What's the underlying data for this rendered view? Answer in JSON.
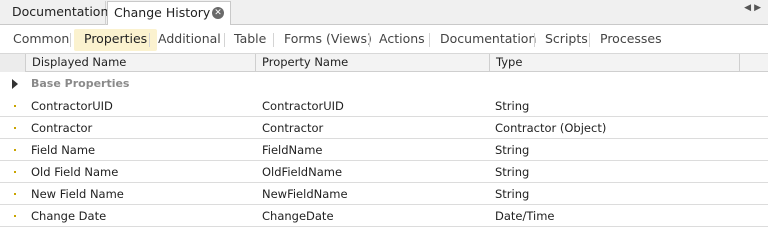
{
  "doc_tabs": [
    {
      "label": "Documentation"
    },
    {
      "label": "Change History *"
    }
  ],
  "close_glyph": "✕",
  "nav": {
    "prev": "◀",
    "next": "▶"
  },
  "sub_tabs": [
    {
      "label": "Common"
    },
    {
      "label": "Properties",
      "active": true
    },
    {
      "label": "Additional"
    },
    {
      "label": "Table"
    },
    {
      "label": "Forms (Views)"
    },
    {
      "label": "Actions"
    },
    {
      "label": "Documentation"
    },
    {
      "label": "Scripts"
    },
    {
      "label": "Processes"
    }
  ],
  "grid": {
    "columns": [
      "Displayed Name",
      "Property Name",
      "Type"
    ],
    "group": "Base Properties",
    "rows": [
      {
        "displayed": "ContractorUID",
        "property": "ContractorUID",
        "type": "String"
      },
      {
        "displayed": "Contractor",
        "property": "Contractor",
        "type": "Contractor (Object)"
      },
      {
        "displayed": "Field Name",
        "property": "FieldName",
        "type": "String"
      },
      {
        "displayed": "Old Field Name",
        "property": "OldFieldName",
        "type": "String"
      },
      {
        "displayed": "New Field Name",
        "property": "NewFieldName",
        "type": "String"
      },
      {
        "displayed": "Change Date",
        "property": "ChangeDate",
        "type": "Date/Time"
      }
    ]
  },
  "colors": {
    "active_tab": "#fbf2cf",
    "row_marker": "#c9a400"
  }
}
